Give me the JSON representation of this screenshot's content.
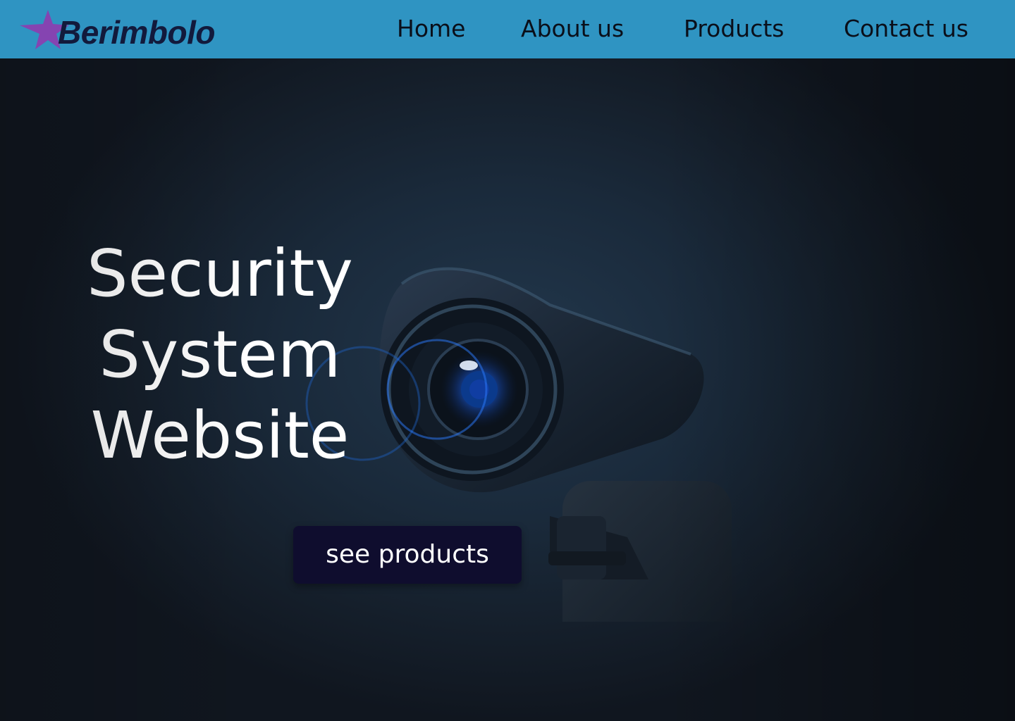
{
  "header": {
    "logo_text": "Berimbolo",
    "nav": {
      "home": "Home",
      "about": "About us",
      "products": "Products",
      "contact": "Contact us"
    }
  },
  "hero": {
    "title_lines": [
      "Security",
      "System",
      "Website"
    ],
    "cta_label": "see products",
    "image_icon": "security-camera-icon"
  },
  "colors": {
    "header_bg": "#2f94c2",
    "logo_text": "#121a3c",
    "logo_star": "#8a3fb0",
    "hero_bg": "#1a2a3b",
    "cta_bg": "#0f0d2e",
    "title": "#ffffff"
  }
}
